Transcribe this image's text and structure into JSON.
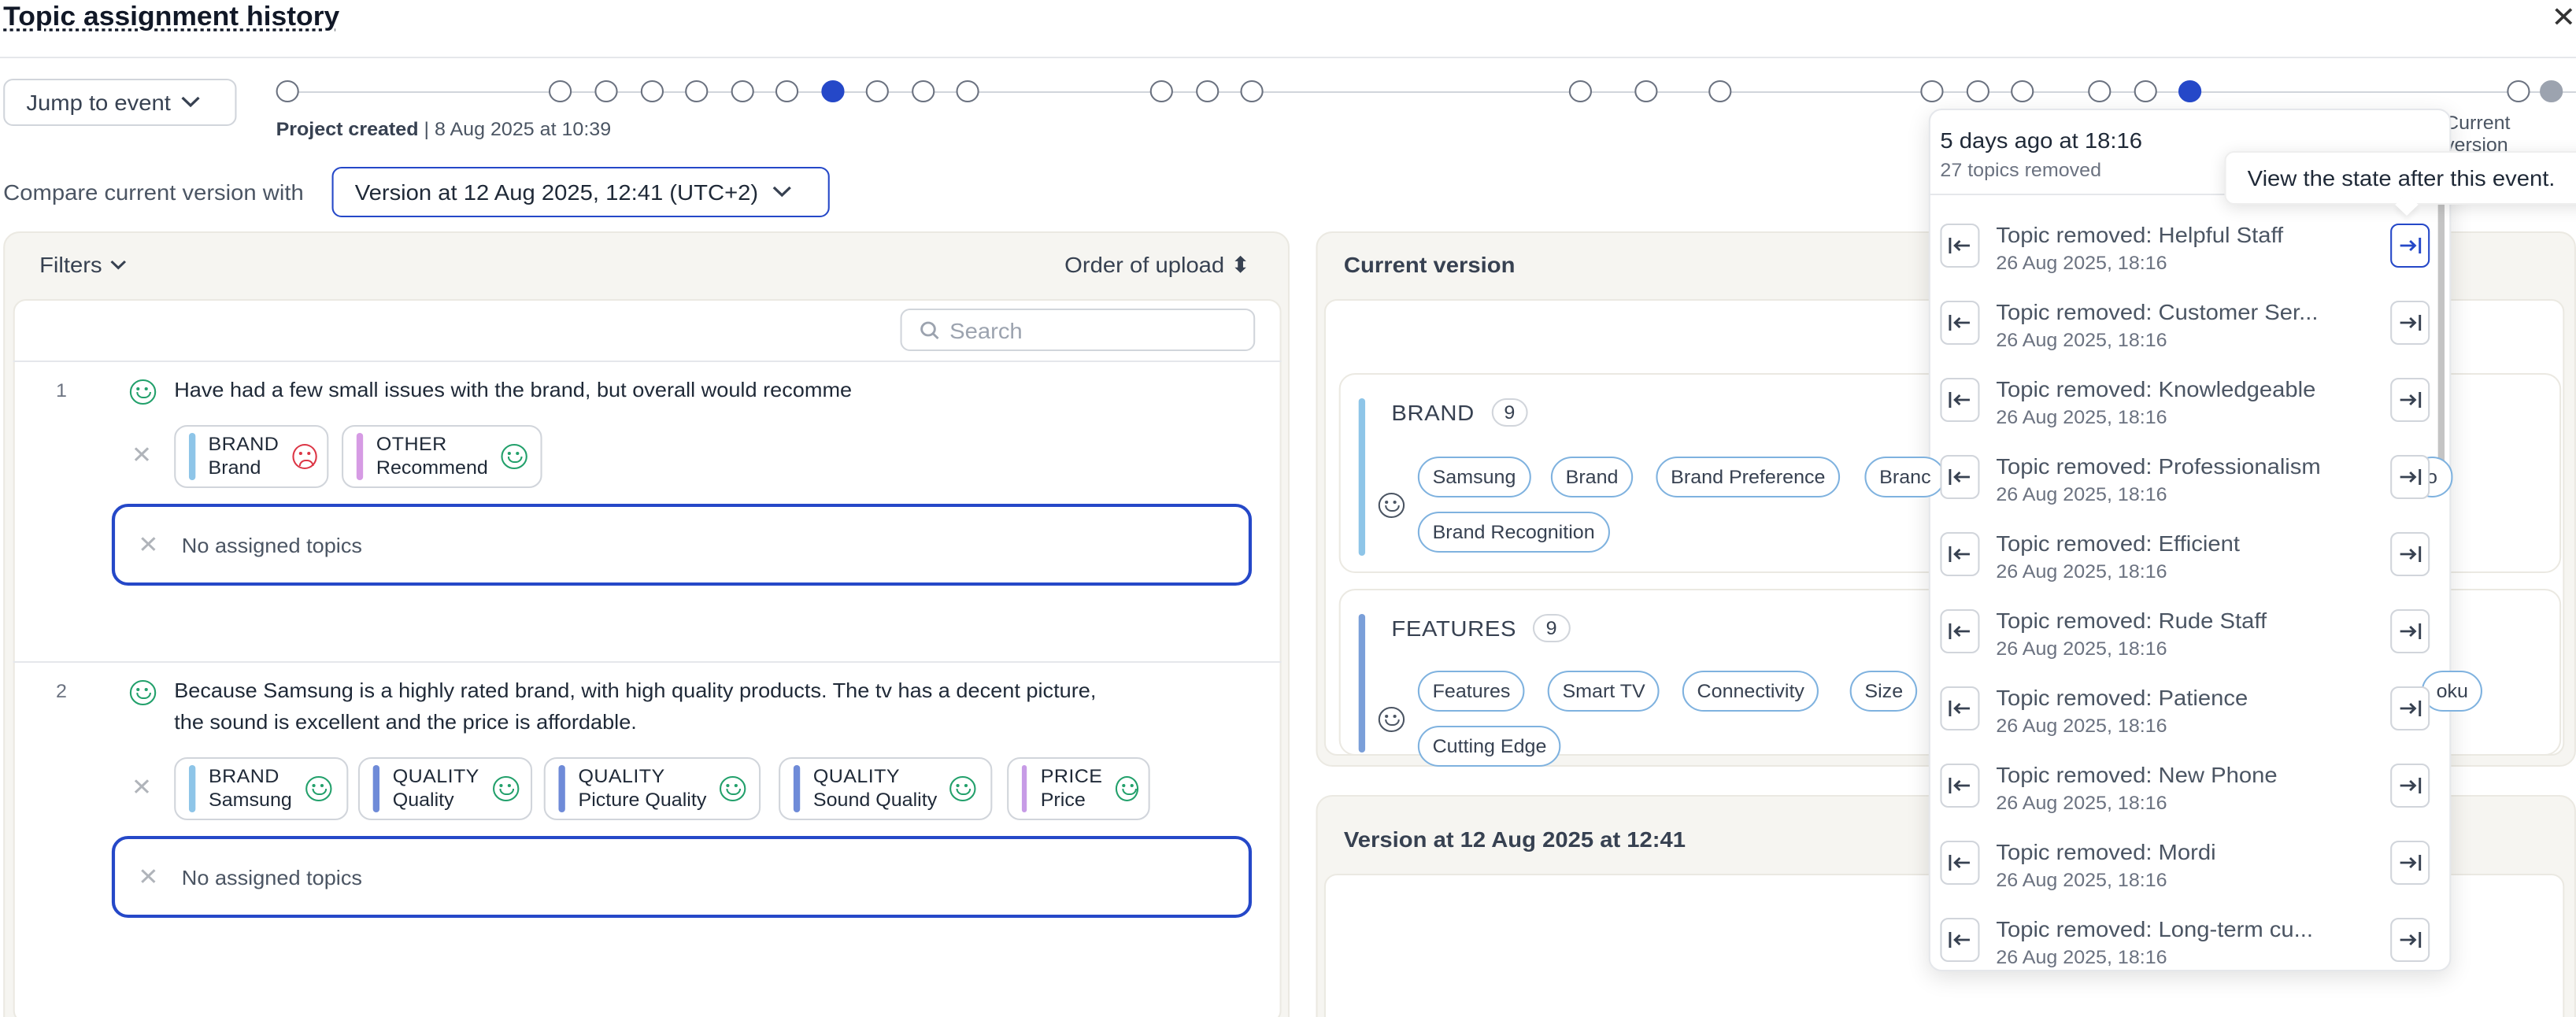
{
  "header": {
    "title": "Topic assignment history",
    "close": "✕"
  },
  "timeline": {
    "jump_label": "Jump to event",
    "project_created": "Project created",
    "project_date": "8 Aug 2025 at 10:39",
    "current_version": "Current version"
  },
  "compare": {
    "label": "Compare current version with",
    "selected": "Version at 12 Aug 2025, 12:41 (UTC+2)"
  },
  "left": {
    "filters": "Filters",
    "order": "Order of upload",
    "search_placeholder": "Search",
    "rows": [
      {
        "num": "1",
        "text": "Have had a few small issues with the brand, but overall would recomme",
        "chips": [
          {
            "cat": "BRAND",
            "topic": "Brand",
            "color": "#8ec5e8",
            "sentiment": "negative"
          },
          {
            "cat": "OTHER",
            "topic": "Recommend",
            "color": "#d69be4",
            "sentiment": "positive"
          }
        ],
        "none": "No assigned topics"
      },
      {
        "num": "2",
        "text1": "Because Samsung is a highly rated brand, with high quality products. The tv has a decent picture,",
        "text2": "the sound is excellent and the price is affordable.",
        "chips": [
          {
            "cat": "BRAND",
            "topic": "Samsung",
            "color": "#8ec5e8",
            "sentiment": "positive"
          },
          {
            "cat": "QUALITY",
            "topic": "Quality",
            "color": "#6f8bd8",
            "sentiment": "positive"
          },
          {
            "cat": "QUALITY",
            "topic": "Picture Quality",
            "color": "#6f8bd8",
            "sentiment": "positive"
          },
          {
            "cat": "QUALITY",
            "topic": "Sound Quality",
            "color": "#6f8bd8",
            "sentiment": "positive"
          },
          {
            "cat": "PRICE",
            "topic": "Price",
            "color": "#c79be6",
            "sentiment": "positive"
          }
        ],
        "none": "No assigned topics"
      }
    ]
  },
  "current": {
    "title": "Current version",
    "groups": [
      {
        "name": "BRAND",
        "count": "9",
        "color": "#8ec5e8",
        "pills": [
          "Samsung",
          "Brand",
          "Brand Preference",
          "Branc",
          "Brand Recognition"
        ],
        "tail": "o"
      },
      {
        "name": "FEATURES",
        "count": "9",
        "color": "#7a9fd9",
        "pills": [
          "Features",
          "Smart TV",
          "Connectivity",
          "Size",
          "Cutting Edge"
        ],
        "tail": "oku"
      }
    ]
  },
  "version2": {
    "title": "Version at 12 Aug 2025 at 12:41"
  },
  "popover": {
    "when": "5 days ago at 18:16",
    "summary": "27 topics removed",
    "tooltip": "View the state after this event.",
    "events": [
      {
        "name": "Topic removed: Helpful Staff",
        "date": "26 Aug 2025, 18:16"
      },
      {
        "name": "Topic removed: Customer Ser...",
        "date": "26 Aug 2025, 18:16"
      },
      {
        "name": "Topic removed: Knowledgeable",
        "date": "26 Aug 2025, 18:16"
      },
      {
        "name": "Topic removed: Professionalism",
        "date": "26 Aug 2025, 18:16"
      },
      {
        "name": "Topic removed: Efficient",
        "date": "26 Aug 2025, 18:16"
      },
      {
        "name": "Topic removed: Rude Staff",
        "date": "26 Aug 2025, 18:16"
      },
      {
        "name": "Topic removed: Patience",
        "date": "26 Aug 2025, 18:16"
      },
      {
        "name": "Topic removed: New Phone",
        "date": "26 Aug 2025, 18:16"
      },
      {
        "name": "Topic removed: Mordi",
        "date": "26 Aug 2025, 18:16"
      },
      {
        "name": "Topic removed: Long-term cu...",
        "date": "26 Aug 2025, 18:16"
      }
    ]
  }
}
